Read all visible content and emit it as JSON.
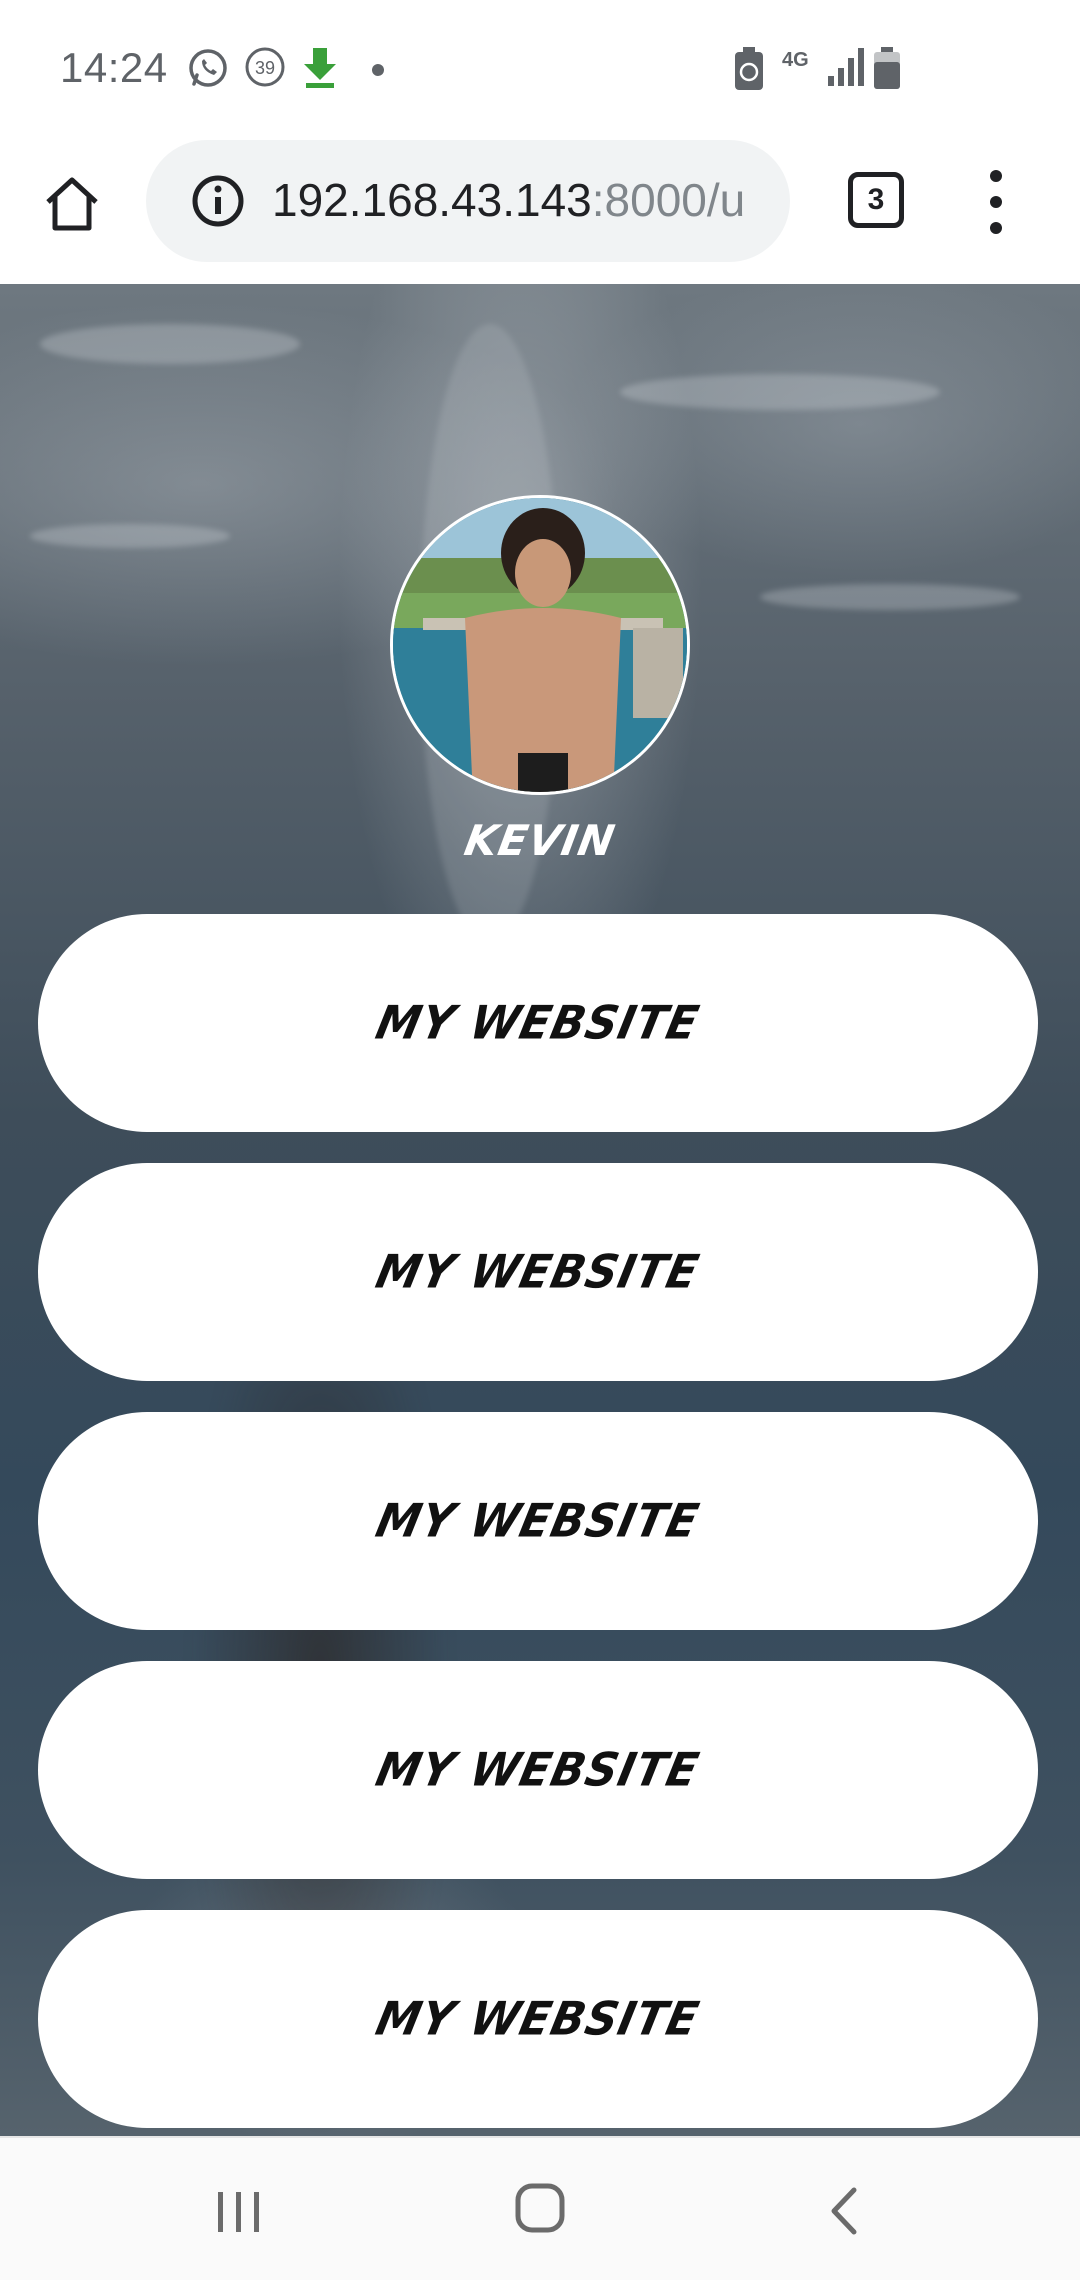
{
  "status_bar": {
    "time": "14:24",
    "notification_count": "39",
    "network_type": "4G",
    "icons": [
      "whatsapp-icon",
      "notification-count-icon",
      "download-icon",
      "dot-icon",
      "battery-saver-icon",
      "signal-icon",
      "battery-icon"
    ]
  },
  "browser": {
    "url_host": "192.168.43.143",
    "url_rest": ":8000/u",
    "tab_count": "3",
    "icons": [
      "home-icon",
      "info-icon",
      "more-vert-icon"
    ]
  },
  "profile": {
    "name": "KEVIN"
  },
  "links": [
    {
      "label": "MY WEBSITE"
    },
    {
      "label": "MY WEBSITE"
    },
    {
      "label": "MY WEBSITE"
    },
    {
      "label": "MY WEBSITE"
    },
    {
      "label": "MY WEBSITE"
    }
  ],
  "nav_bar": {
    "icons": [
      "recents-icon",
      "home-circle-icon",
      "back-icon"
    ]
  },
  "colors": {
    "button_bg": "#ffffff",
    "button_text": "#111111",
    "name_text": "#ffffff",
    "omnibox_bg": "#f1f3f4"
  }
}
